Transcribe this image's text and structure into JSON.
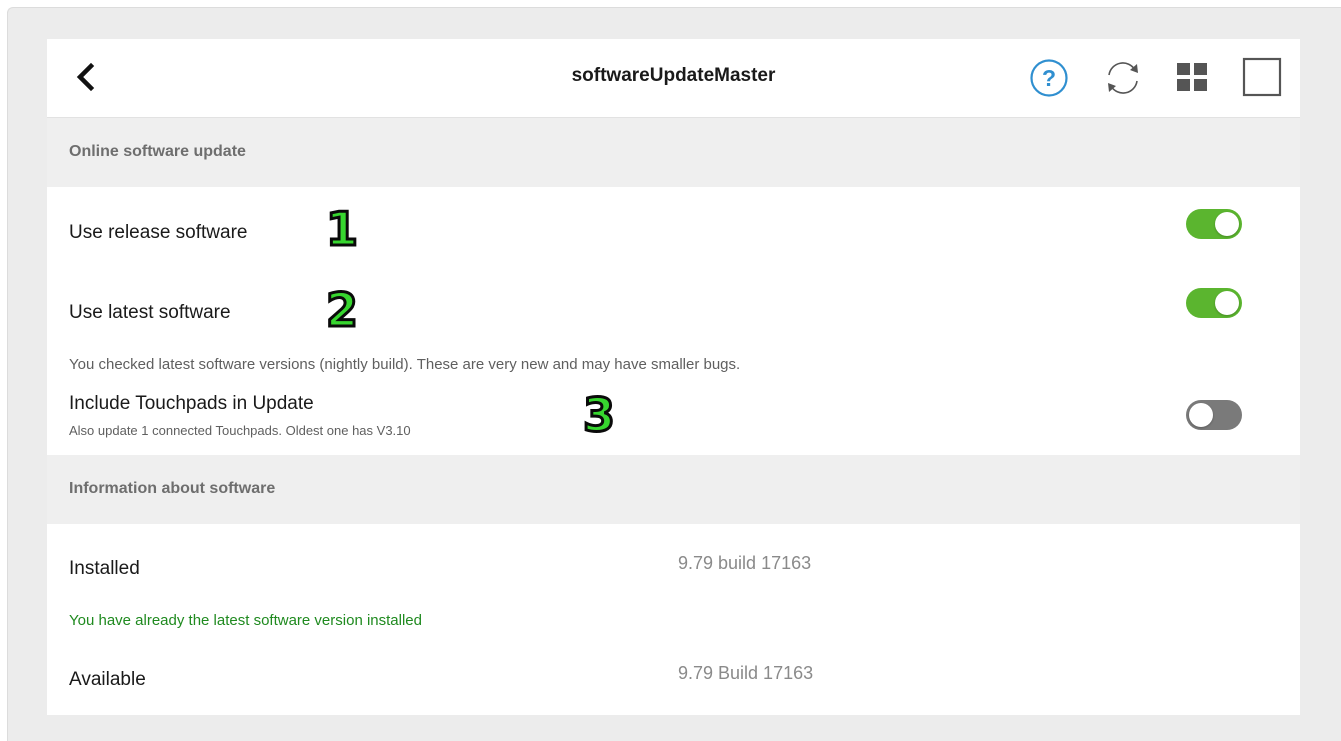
{
  "header": {
    "title": "softwareUpdateMaster",
    "icons": [
      "chevron-left-icon",
      "help-icon",
      "refresh-icon",
      "grid-icon",
      "square-icon"
    ]
  },
  "sections": {
    "online": {
      "heading": "Online software update",
      "release_label": "Use release software",
      "release_on": true,
      "latest_label": "Use latest software",
      "latest_on": true,
      "latest_note": "You checked latest software versions (nightly build). These are very new and may have smaller bugs.",
      "touchpads_label": "Include Touchpads in Update",
      "touchpads_note": "Also update 1 connected Touchpads. Oldest one has V3.10",
      "touchpads_on": false
    },
    "info": {
      "heading": "Information about software",
      "installed_label": "Installed",
      "installed_value": "9.79 build 17163",
      "status_note": "You have already the latest software version installed",
      "available_label": "Available",
      "available_value": "9.79 Build 17163"
    }
  },
  "markers": [
    "1",
    "2",
    "3"
  ],
  "colors": {
    "toggle_on": "#5bb52f",
    "toggle_off": "#7a7a7a",
    "status_green": "#1f8a1f",
    "help_blue": "#2f8fd0",
    "marker_green": "#37d62f"
  }
}
